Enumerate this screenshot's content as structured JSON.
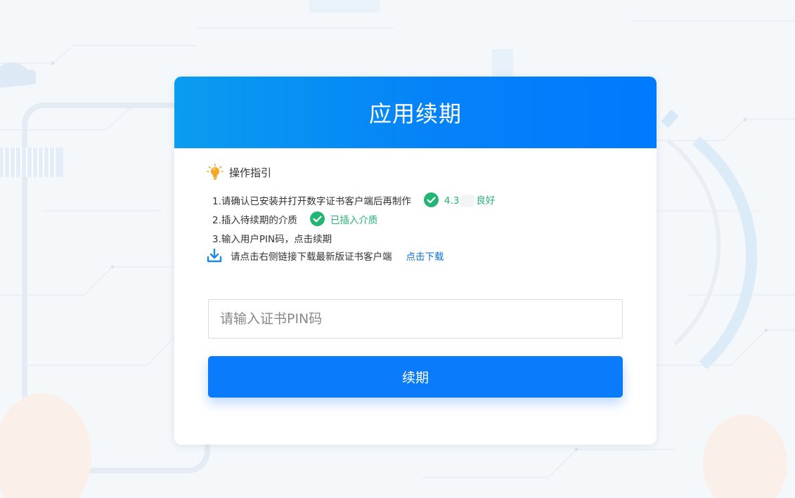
{
  "page": {
    "title": "应用续期"
  },
  "guide": {
    "title": "操作指引",
    "steps": [
      {
        "text": "1.请确认已安装并打开数字证书客户端后再制作",
        "status_prefix": "4.3",
        "status_suffix": "良好"
      },
      {
        "text": "2.插入待续期的介质",
        "status": "已插入介质"
      },
      {
        "text": "3.输入用户PIN码，点击续期"
      }
    ],
    "download": {
      "text": "请点击右侧链接下载最新版证书客户端",
      "link_label": "点击下载"
    }
  },
  "form": {
    "pin_placeholder": "请输入证书PIN码",
    "pin_value": ""
  },
  "actions": {
    "renew_label": "续期"
  },
  "colors": {
    "header_gradient_start": "#0a9cf0",
    "header_gradient_end": "#007aff",
    "primary_button": "#0a7bfb",
    "success": "#22b573",
    "link": "#0a72d8",
    "bulb": "#f5a623"
  },
  "icons": {
    "guide": "lightbulb-icon",
    "status": "check-circle-icon",
    "download": "download-icon"
  }
}
